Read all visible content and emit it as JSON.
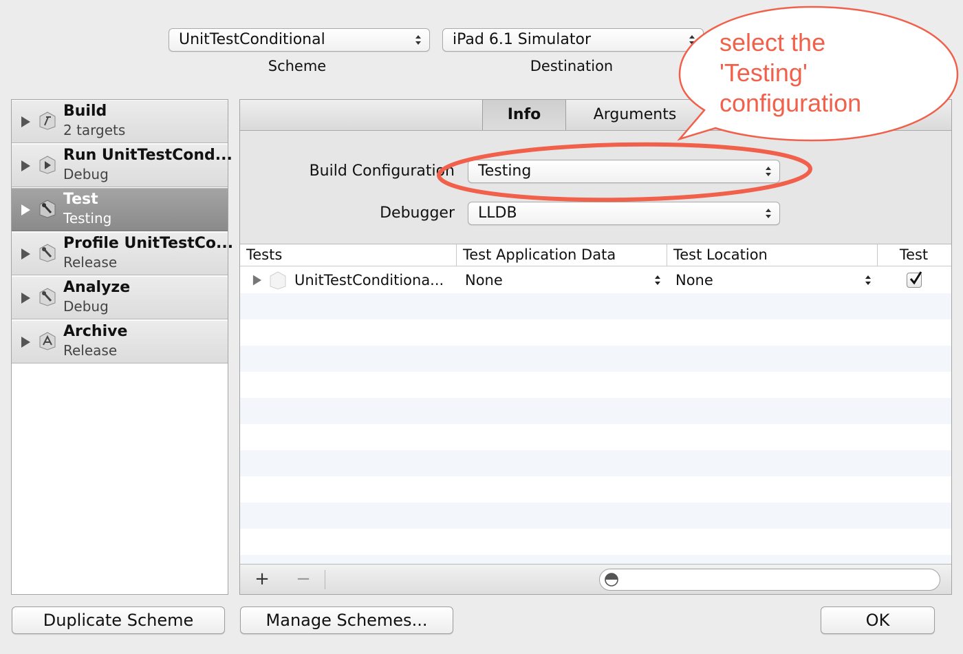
{
  "toolbar": {
    "scheme_value": "UnitTestConditional",
    "scheme_caption": "Scheme",
    "destination_value": "iPad 6.1 Simulator",
    "destination_caption": "Destination"
  },
  "sidebar": {
    "actions": [
      {
        "title": "Build",
        "subtitle": "2 targets",
        "icon": "hammer-icon"
      },
      {
        "title": "Run UnitTestCond...",
        "subtitle": "Debug",
        "icon": "play-icon"
      },
      {
        "title": "Test",
        "subtitle": "Testing",
        "icon": "wrench-icon",
        "selected": true
      },
      {
        "title": "Profile UnitTestCo...",
        "subtitle": "Release",
        "icon": "wrench-icon"
      },
      {
        "title": "Analyze",
        "subtitle": "Debug",
        "icon": "wrench-icon"
      },
      {
        "title": "Archive",
        "subtitle": "Release",
        "icon": "archive-icon"
      }
    ]
  },
  "tabs": [
    {
      "label": "Info",
      "active": true
    },
    {
      "label": "Arguments",
      "active": false
    }
  ],
  "form": {
    "build_configuration_label": "Build Configuration",
    "build_configuration_value": "Testing",
    "debugger_label": "Debugger",
    "debugger_value": "LLDB"
  },
  "tests_table": {
    "columns": [
      "Tests",
      "Test Application Data",
      "Test Location",
      "Test"
    ],
    "rows": [
      {
        "name": "UnitTestConditiona...",
        "app_data": "None",
        "location": "None",
        "checked": true
      }
    ]
  },
  "bottom_bar": {
    "add_label": "+",
    "remove_label": "−"
  },
  "buttons": {
    "duplicate": "Duplicate Scheme",
    "manage": "Manage Schemes...",
    "ok": "OK"
  },
  "annotation": {
    "callout_text": "select the\n'Testing'\nconfiguration",
    "color": "#f0604a"
  }
}
